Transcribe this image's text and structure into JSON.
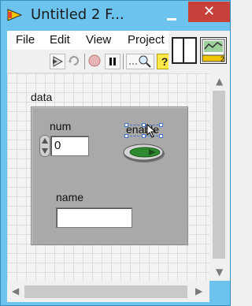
{
  "window": {
    "title": "Untitled 2 F...",
    "minimize_icon": "minimize-icon",
    "close_label": "✕"
  },
  "menu": [
    "File",
    "Edit",
    "View",
    "Project"
  ],
  "toolbar": {
    "icons": [
      "run-arrow-icon",
      "run-continuously-icon",
      "abort-execution-icon",
      "pause-icon",
      "highlight-execution-icon",
      "context-help-icon"
    ],
    "help_label": "?"
  },
  "connector": {
    "vi_icon_number": "2"
  },
  "front_panel": {
    "cluster_label": "data",
    "num": {
      "label": "num",
      "value": "0"
    },
    "enable": {
      "label": "enable"
    },
    "name": {
      "label": "name",
      "value": ""
    }
  },
  "colors": {
    "titlebar": "#6cc4ee",
    "close_button": "#c7403a",
    "cluster_bg": "#a9a9a9",
    "led": "#2f8a2f"
  }
}
